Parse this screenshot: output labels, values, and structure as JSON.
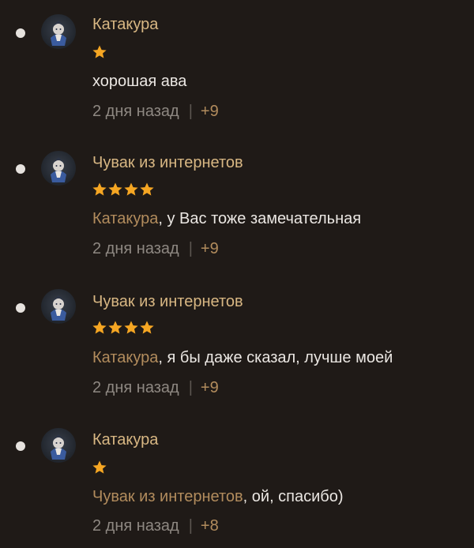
{
  "colors": {
    "background": "#1f1a17",
    "author": "#d8b783",
    "mention": "#b28c5d",
    "star": "#f5a623",
    "meta": "#8e8882",
    "text": "#ebe7e3"
  },
  "comments": [
    {
      "author": "Катакура",
      "stars": 1,
      "mention": "",
      "text": "хорошая ава",
      "time": "2 дня назад",
      "separator": "|",
      "votes": "+9",
      "avatar_icon": "anime-character-avatar-icon"
    },
    {
      "author": "Чувак из интернетов",
      "stars": 4,
      "mention": "Катакура",
      "text": ", у Вас тоже замечательная",
      "time": "2 дня назад",
      "separator": "|",
      "votes": "+9",
      "avatar_icon": "anime-character-avatar-icon"
    },
    {
      "author": "Чувак из интернетов",
      "stars": 4,
      "mention": "Катакура",
      "text": ", я бы даже сказал, лучше моей",
      "time": "2 дня назад",
      "separator": "|",
      "votes": "+9",
      "avatar_icon": "anime-character-avatar-icon"
    },
    {
      "author": "Катакура",
      "stars": 1,
      "mention": "Чувак из интернетов",
      "text": ", ой, спасибо)",
      "time": "2 дня назад",
      "separator": "|",
      "votes": "+8",
      "avatar_icon": "anime-character-avatar-icon"
    }
  ]
}
